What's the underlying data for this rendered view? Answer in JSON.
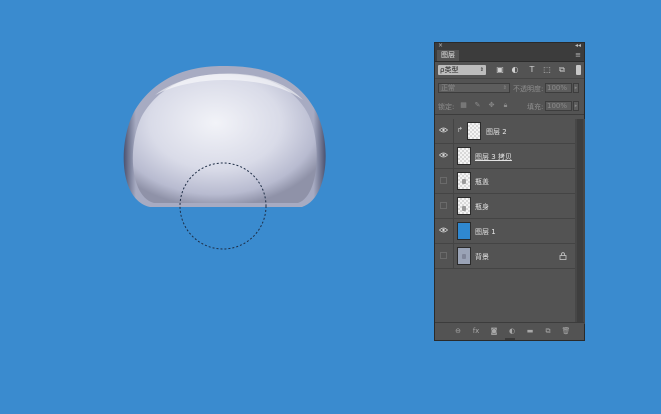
{
  "panel": {
    "tab_label": "图层",
    "filter": {
      "value": "ρ类型"
    },
    "blend_mode": {
      "value": "正常"
    },
    "opacity": {
      "label": "不透明度:",
      "value": "100%"
    },
    "lock": {
      "label": "锁定:"
    },
    "fill": {
      "label": "填充:",
      "value": "100%"
    }
  },
  "layers": [
    {
      "name": "图层 2",
      "visible": true,
      "clipped": true,
      "thumbnail": "transparent",
      "locked": false
    },
    {
      "name": "图层 3 拷贝",
      "visible": true,
      "clipped": false,
      "thumbnail": "transparent",
      "locked": false
    },
    {
      "name": "瓶盖",
      "visible": false,
      "clipped": false,
      "thumbnail": "transparent",
      "locked": false
    },
    {
      "name": "瓶身",
      "visible": false,
      "clipped": false,
      "thumbnail": "transparent",
      "locked": false
    },
    {
      "name": "图层 1",
      "visible": true,
      "clipped": false,
      "thumbnail": "blue",
      "locked": false
    },
    {
      "name": "背景",
      "visible": false,
      "clipped": false,
      "thumbnail": "gray",
      "locked": true
    }
  ],
  "colors": {
    "canvas_background": "#3a8bcf",
    "panel_background": "#535353",
    "panel_dark": "#3c3c3c"
  }
}
